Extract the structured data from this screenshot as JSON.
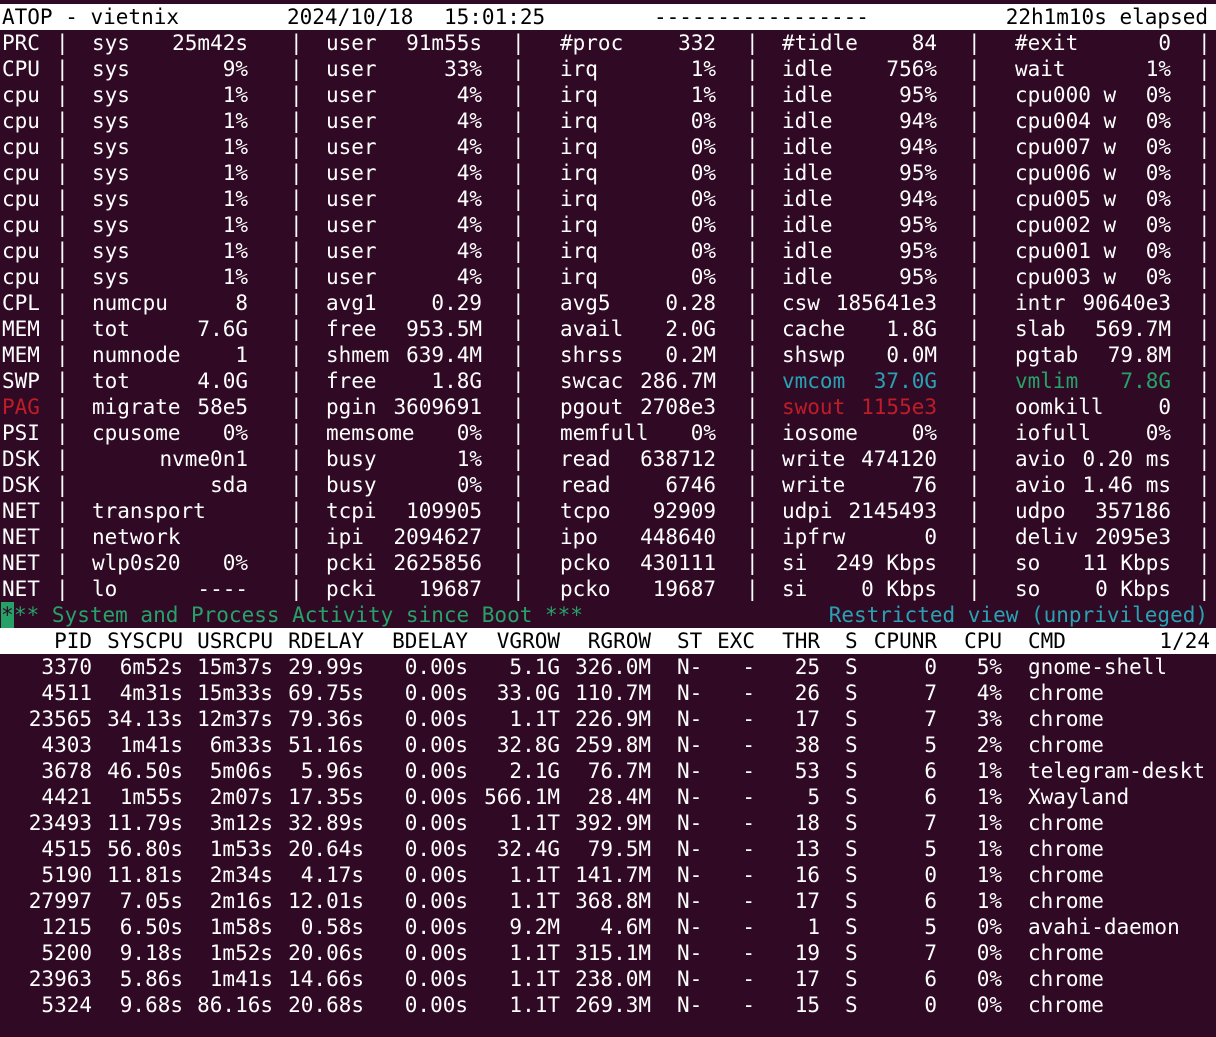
{
  "header": {
    "title": "ATOP - vietnix",
    "date": "2024/10/18",
    "time": "15:01:25",
    "dashes": "-----------------",
    "elapsed": "22h1m10s elapsed"
  },
  "system_rows": [
    {
      "label": "PRC",
      "cells": [
        [
          "sys",
          "25m42s"
        ],
        [
          "user",
          "91m55s"
        ],
        [
          "#proc",
          "332"
        ],
        [
          "#tidle",
          "84"
        ],
        [
          "#exit",
          "0"
        ]
      ]
    },
    {
      "label": "CPU",
      "cells": [
        [
          "sys",
          "9%"
        ],
        [
          "user",
          "33%"
        ],
        [
          "irq",
          "1%"
        ],
        [
          "idle",
          "756%"
        ],
        [
          "wait",
          "1%"
        ]
      ]
    },
    {
      "label": "cpu",
      "cells": [
        [
          "sys",
          "1%"
        ],
        [
          "user",
          "4%"
        ],
        [
          "irq",
          "1%"
        ],
        [
          "idle",
          "95%"
        ],
        [
          "cpu000 w",
          "0%"
        ]
      ]
    },
    {
      "label": "cpu",
      "cells": [
        [
          "sys",
          "1%"
        ],
        [
          "user",
          "4%"
        ],
        [
          "irq",
          "0%"
        ],
        [
          "idle",
          "94%"
        ],
        [
          "cpu004 w",
          "0%"
        ]
      ]
    },
    {
      "label": "cpu",
      "cells": [
        [
          "sys",
          "1%"
        ],
        [
          "user",
          "4%"
        ],
        [
          "irq",
          "0%"
        ],
        [
          "idle",
          "94%"
        ],
        [
          "cpu007 w",
          "0%"
        ]
      ]
    },
    {
      "label": "cpu",
      "cells": [
        [
          "sys",
          "1%"
        ],
        [
          "user",
          "4%"
        ],
        [
          "irq",
          "0%"
        ],
        [
          "idle",
          "95%"
        ],
        [
          "cpu006 w",
          "0%"
        ]
      ]
    },
    {
      "label": "cpu",
      "cells": [
        [
          "sys",
          "1%"
        ],
        [
          "user",
          "4%"
        ],
        [
          "irq",
          "0%"
        ],
        [
          "idle",
          "94%"
        ],
        [
          "cpu005 w",
          "0%"
        ]
      ]
    },
    {
      "label": "cpu",
      "cells": [
        [
          "sys",
          "1%"
        ],
        [
          "user",
          "4%"
        ],
        [
          "irq",
          "0%"
        ],
        [
          "idle",
          "95%"
        ],
        [
          "cpu002 w",
          "0%"
        ]
      ]
    },
    {
      "label": "cpu",
      "cells": [
        [
          "sys",
          "1%"
        ],
        [
          "user",
          "4%"
        ],
        [
          "irq",
          "0%"
        ],
        [
          "idle",
          "95%"
        ],
        [
          "cpu001 w",
          "0%"
        ]
      ]
    },
    {
      "label": "cpu",
      "cells": [
        [
          "sys",
          "1%"
        ],
        [
          "user",
          "4%"
        ],
        [
          "irq",
          "0%"
        ],
        [
          "idle",
          "95%"
        ],
        [
          "cpu003 w",
          "0%"
        ]
      ]
    },
    {
      "label": "CPL",
      "cells": [
        [
          "numcpu",
          "8"
        ],
        [
          "avg1",
          "0.29"
        ],
        [
          "avg5",
          "0.28"
        ],
        [
          "csw",
          "185641e3"
        ],
        [
          "intr",
          "90640e3"
        ]
      ]
    },
    {
      "label": "MEM",
      "cells": [
        [
          "tot",
          "7.6G"
        ],
        [
          "free",
          "953.5M"
        ],
        [
          "avail",
          "2.0G"
        ],
        [
          "cache",
          "1.8G"
        ],
        [
          "slab",
          "569.7M"
        ]
      ]
    },
    {
      "label": "MEM",
      "cells": [
        [
          "numnode",
          "1"
        ],
        [
          "shmem",
          "639.4M"
        ],
        [
          "shrss",
          "0.2M"
        ],
        [
          "shswp",
          "0.0M"
        ],
        [
          "pgtab",
          "79.8M"
        ]
      ]
    },
    {
      "label": "SWP",
      "cells": [
        [
          "tot",
          "4.0G"
        ],
        [
          "free",
          "1.8G"
        ],
        [
          "swcac",
          "286.7M"
        ],
        [
          "vmcom",
          "37.0G"
        ],
        [
          "vmlim",
          "7.8G"
        ]
      ]
    },
    {
      "label": "PAG",
      "cells": [
        [
          "migrate",
          "58e5"
        ],
        [
          "pgin",
          "3609691"
        ],
        [
          "pgout",
          "2708e3"
        ],
        [
          "swout",
          "1155e3"
        ],
        [
          "oomkill",
          "0"
        ]
      ]
    },
    {
      "label": "PSI",
      "cells": [
        [
          "cpusome",
          "0%"
        ],
        [
          "memsome",
          "0%"
        ],
        [
          "memfull",
          "0%"
        ],
        [
          "iosome",
          "0%"
        ],
        [
          "iofull",
          "0%"
        ]
      ]
    },
    {
      "label": "DSK",
      "cells": [
        [
          "",
          "nvme0n1"
        ],
        [
          "busy",
          "1%"
        ],
        [
          "read",
          "638712"
        ],
        [
          "write",
          "474120"
        ],
        [
          "avio",
          "0.20 ms"
        ]
      ]
    },
    {
      "label": "DSK",
      "cells": [
        [
          "",
          "sda"
        ],
        [
          "busy",
          "0%"
        ],
        [
          "read",
          "6746"
        ],
        [
          "write",
          "76"
        ],
        [
          "avio",
          "1.46 ms"
        ]
      ]
    },
    {
      "label": "NET",
      "cells": [
        [
          "transport",
          ""
        ],
        [
          "tcpi",
          "109905"
        ],
        [
          "tcpo",
          "92909"
        ],
        [
          "udpi",
          "2145493"
        ],
        [
          "udpo",
          "357186"
        ]
      ]
    },
    {
      "label": "NET",
      "cells": [
        [
          "network",
          ""
        ],
        [
          "ipi",
          "2094627"
        ],
        [
          "ipo",
          "448640"
        ],
        [
          "ipfrw",
          "0"
        ],
        [
          "deliv",
          "2095e3"
        ]
      ]
    },
    {
      "label": "NET",
      "cells": [
        [
          "wlp0s20",
          "0%"
        ],
        [
          "pcki",
          "2625856"
        ],
        [
          "pcko",
          "430111"
        ],
        [
          "si",
          "249 Kbps"
        ],
        [
          "so",
          "11 Kbps"
        ]
      ]
    },
    {
      "label": "NET",
      "cells": [
        [
          "lo",
          "----"
        ],
        [
          "pcki",
          "19687"
        ],
        [
          "pcko",
          "19687"
        ],
        [
          "si",
          "0 Kbps"
        ],
        [
          "so",
          "0 Kbps"
        ]
      ]
    }
  ],
  "colors": {
    "background": "#300a24",
    "foreground": "#ffffff",
    "cyan": "#2aa1b3",
    "green": "#26a269",
    "red": "#c01c28"
  },
  "highlight": {
    "vmcom": "cyan",
    "vmlim": "green",
    "PAG": "red",
    "swout": "red"
  },
  "status_line": {
    "cursor": "*",
    "left": "** System and Process Activity since Boot ***",
    "right": "Restricted view (unprivileged)"
  },
  "proc_header": [
    "PID",
    "SYSCPU",
    "USRCPU",
    "RDELAY",
    "BDELAY",
    "VGROW",
    "RGROW",
    "ST",
    "EXC",
    "THR",
    "S",
    "CPUNR",
    "CPU",
    "CMD"
  ],
  "page_indicator": "1/24",
  "processes": [
    [
      "3370",
      "6m52s",
      "15m37s",
      "29.99s",
      "0.00s",
      "5.1G",
      "326.0M",
      "N-",
      "-",
      "25",
      "S",
      "0",
      "5%",
      "gnome-shell"
    ],
    [
      "4511",
      "4m31s",
      "15m33s",
      "69.75s",
      "0.00s",
      "33.0G",
      "110.7M",
      "N-",
      "-",
      "26",
      "S",
      "7",
      "4%",
      "chrome"
    ],
    [
      "23565",
      "34.13s",
      "12m37s",
      "79.36s",
      "0.00s",
      "1.1T",
      "226.9M",
      "N-",
      "-",
      "17",
      "S",
      "7",
      "3%",
      "chrome"
    ],
    [
      "4303",
      "1m41s",
      "6m33s",
      "51.16s",
      "0.00s",
      "32.8G",
      "259.8M",
      "N-",
      "-",
      "38",
      "S",
      "5",
      "2%",
      "chrome"
    ],
    [
      "3678",
      "46.50s",
      "5m06s",
      "5.96s",
      "0.00s",
      "2.1G",
      "76.7M",
      "N-",
      "-",
      "53",
      "S",
      "6",
      "1%",
      "telegram-deskt"
    ],
    [
      "4421",
      "1m55s",
      "2m07s",
      "17.35s",
      "0.00s",
      "566.1M",
      "28.4M",
      "N-",
      "-",
      "5",
      "S",
      "6",
      "1%",
      "Xwayland"
    ],
    [
      "23493",
      "11.79s",
      "3m12s",
      "32.89s",
      "0.00s",
      "1.1T",
      "392.9M",
      "N-",
      "-",
      "18",
      "S",
      "7",
      "1%",
      "chrome"
    ],
    [
      "4515",
      "56.80s",
      "1m53s",
      "20.64s",
      "0.00s",
      "32.4G",
      "79.5M",
      "N-",
      "-",
      "13",
      "S",
      "5",
      "1%",
      "chrome"
    ],
    [
      "5190",
      "11.81s",
      "2m34s",
      "4.17s",
      "0.00s",
      "1.1T",
      "141.7M",
      "N-",
      "-",
      "16",
      "S",
      "0",
      "1%",
      "chrome"
    ],
    [
      "27997",
      "7.05s",
      "2m16s",
      "12.01s",
      "0.00s",
      "1.1T",
      "368.8M",
      "N-",
      "-",
      "17",
      "S",
      "6",
      "1%",
      "chrome"
    ],
    [
      "1215",
      "6.50s",
      "1m58s",
      "0.58s",
      "0.00s",
      "9.2M",
      "4.6M",
      "N-",
      "-",
      "1",
      "S",
      "5",
      "0%",
      "avahi-daemon"
    ],
    [
      "5200",
      "9.18s",
      "1m52s",
      "20.06s",
      "0.00s",
      "1.1T",
      "315.1M",
      "N-",
      "-",
      "19",
      "S",
      "7",
      "0%",
      "chrome"
    ],
    [
      "23963",
      "5.86s",
      "1m41s",
      "14.66s",
      "0.00s",
      "1.1T",
      "238.0M",
      "N-",
      "-",
      "17",
      "S",
      "6",
      "0%",
      "chrome"
    ],
    [
      "5324",
      "9.68s",
      "86.16s",
      "20.68s",
      "0.00s",
      "1.1T",
      "269.3M",
      "N-",
      "-",
      "15",
      "S",
      "0",
      "0%",
      "chrome"
    ]
  ]
}
